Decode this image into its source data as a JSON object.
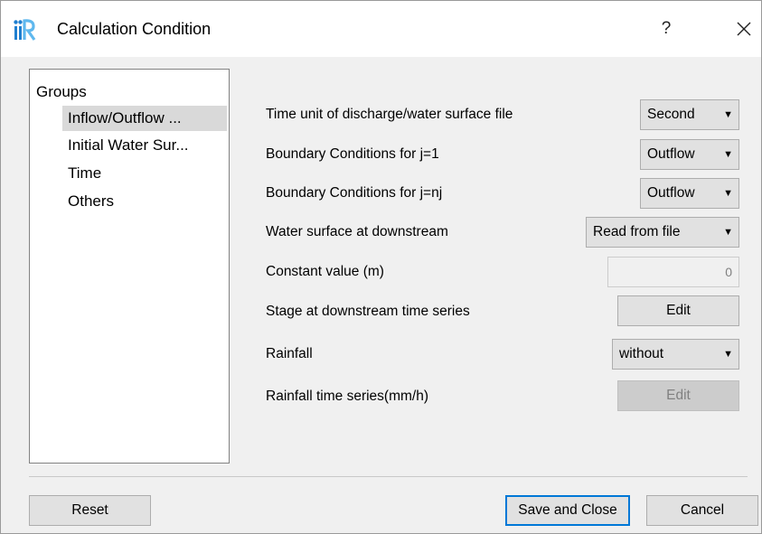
{
  "window": {
    "title": "Calculation Condition",
    "help_label": "?",
    "close_icon": "close-icon",
    "app_icon": "iric-logo-icon",
    "accent_color": "#0078d7"
  },
  "groups": {
    "header": "Groups",
    "items": [
      {
        "label": "Inflow/Outflow ...",
        "selected": true
      },
      {
        "label": "Initial Water Sur...",
        "selected": false
      },
      {
        "label": "Time",
        "selected": false
      },
      {
        "label": "Others",
        "selected": false
      }
    ]
  },
  "settings": {
    "time_unit": {
      "label": "Time unit of discharge/water surface file",
      "value": "Second"
    },
    "bc_j1": {
      "label": "Boundary Conditions for j=1",
      "value": "Outflow"
    },
    "bc_jnj": {
      "label": "Boundary Conditions for j=nj",
      "value": "Outflow"
    },
    "ws_downstream": {
      "label": "Water surface at downstream",
      "value": "Read from file"
    },
    "constant_value": {
      "label": "Constant value (m)",
      "value": "0",
      "enabled": false
    },
    "stage_series": {
      "label": "Stage at downstream time series",
      "button": "Edit"
    },
    "rainfall": {
      "label": "Rainfall",
      "value": "without"
    },
    "rainfall_series": {
      "label": "Rainfall time series(mm/h)",
      "button": "Edit",
      "enabled": false
    }
  },
  "footer": {
    "reset": "Reset",
    "save_close": "Save and Close",
    "cancel": "Cancel"
  }
}
